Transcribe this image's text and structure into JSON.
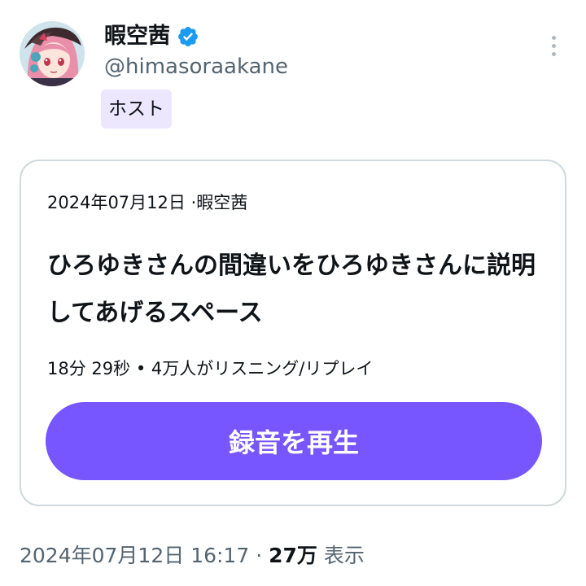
{
  "author": {
    "display_name": "暇空茜",
    "handle": "@himasoraakane",
    "verified": true,
    "role_badge": "ホスト",
    "avatar_icon": "anime-avatar-icon",
    "verified_icon": "verified-badge-icon",
    "colors": {
      "verified": "#1d9bf0",
      "badge_bg": "#ece6ff"
    }
  },
  "menu": {
    "icon": "more-vertical-icon"
  },
  "space_card": {
    "meta_date": "2024年07月12日",
    "meta_sep": "·",
    "meta_host": "暇空茜",
    "title": "ひろゆきさんの間違いをひろゆきさんに説明してあげるスペース",
    "duration": "18分 29秒",
    "stats_sep": "•",
    "listeners": "4万人がリスニング/リプレイ",
    "play_label": "録音を再生",
    "colors": {
      "play_button": "#7856ff"
    }
  },
  "footer": {
    "timestamp": "2024年07月12日 16:17",
    "sep": "·",
    "views_count": "27万",
    "views_label": "表示"
  }
}
